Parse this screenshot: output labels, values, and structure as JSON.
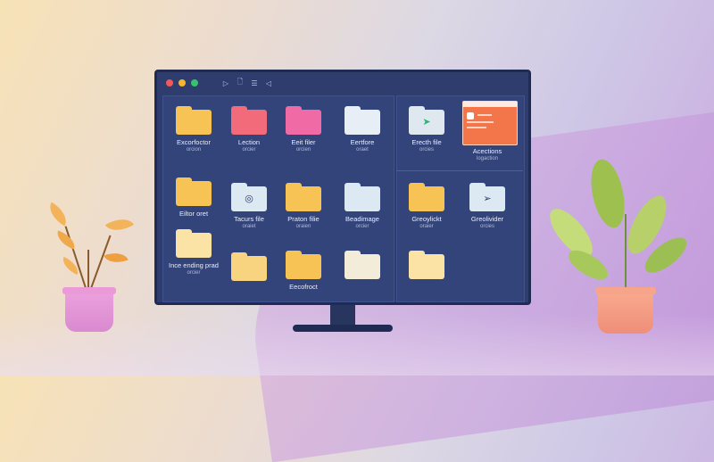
{
  "colors": {
    "monitor_bg": "#2e3d6e",
    "accent_red": "#f05a5a",
    "accent_amber": "#f5b531",
    "accent_green": "#35c46b"
  },
  "window": {
    "controls": [
      "close",
      "minimize",
      "maximize"
    ],
    "toolbar_icons": [
      "play-icon",
      "document-icon",
      "list-icon",
      "share-icon"
    ]
  },
  "files": [
    {
      "name": "Excorfoctor",
      "sub": "orcion",
      "folder_color": "#f6c354",
      "icon": "folder-icon"
    },
    {
      "name": "Lection",
      "sub": "orcier",
      "folder_color": "#f26b7a",
      "icon": "folder-icon"
    },
    {
      "name": "Eeit filer",
      "sub": "orcien",
      "folder_color": "#f06aa6",
      "icon": "folder-icon"
    },
    {
      "name": "Eertfore",
      "sub": "oraet",
      "folder_color": "#e8eef6",
      "icon": "folder-icon"
    },
    {
      "name": "Erecth file",
      "sub": "orcies",
      "folder_color": "#dfe8ef",
      "icon": "folder-icon"
    },
    {
      "name": "Acections",
      "sub": "logaction",
      "folder_color": "#f2764a",
      "icon": "app-window-icon"
    },
    {
      "name": "Eiltor oret",
      "sub": "",
      "folder_color": "#f6c354",
      "icon": "folder-icon"
    },
    {
      "name": "Tacurs file",
      "sub": "oraiet",
      "folder_color": "#dce8f2",
      "icon": "target-icon"
    },
    {
      "name": "Praton filie",
      "sub": "oraien",
      "folder_color": "#f6c354",
      "icon": "folder-icon"
    },
    {
      "name": "Beadimage",
      "sub": "orcier",
      "folder_color": "#dce8f2",
      "icon": "folder-icon"
    },
    {
      "name": "Greoylickt",
      "sub": "oraier",
      "folder_color": "#f6c354",
      "icon": "folder-icon"
    },
    {
      "name": "Greolivider",
      "sub": "orcies",
      "folder_color": "#dce8f2",
      "icon": "paper-plane-icon"
    },
    {
      "name": "Ince ending prad",
      "sub": "orcier",
      "folder_color": "#fbe3a6",
      "icon": "folder-icon"
    },
    {
      "name": "",
      "sub": "",
      "folder_color": "#f8d480",
      "icon": "folder-icon"
    },
    {
      "name": "Eecofroct",
      "sub": "",
      "folder_color": "#f6c354",
      "icon": "folder-icon"
    },
    {
      "name": "",
      "sub": "",
      "folder_color": "#f3ecd8",
      "icon": "folder-icon"
    },
    {
      "name": "",
      "sub": "",
      "folder_color": "#fbe3a6",
      "icon": "folder-icon"
    }
  ]
}
